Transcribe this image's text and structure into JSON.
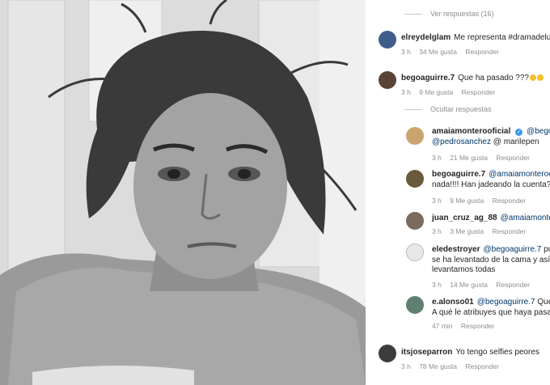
{
  "photo": {
    "alt": ""
  },
  "comments": {
    "view_replies": "Ver respuestas (16)",
    "hide_replies": "Ocultar respuestas",
    "items": [
      {
        "user": "elreydelglam",
        "text": "Me representa #dramadelun",
        "time": "3 h",
        "likes": "34 Me gusta",
        "reply": "Responder"
      },
      {
        "user": "begoaguirre.7",
        "text": "Que ha pasado ???",
        "time": "3 h",
        "likes": "9 Me gusta",
        "reply": "Responder"
      }
    ],
    "replies": [
      {
        "user": "amaiamonterooficial",
        "mention1": "@begoa",
        "mention2": "@pedrosanchez",
        "text2": "@ marilepen",
        "time": "3 h",
        "likes": "21 Me gusta",
        "reply": "Responder"
      },
      {
        "user": "begoaguirre.7",
        "mention1": "@amaiamonteroo",
        "line2": "nada!!!! Han jadeando la cuenta?",
        "time": "3 h",
        "likes": "9 Me gusta",
        "reply": "Responder"
      },
      {
        "user": "juan_cruz_ag_88",
        "mention1": "@amaiamonte",
        "time": "3 h",
        "likes": "3 Me gusta",
        "reply": "Responder"
      },
      {
        "user": "eledestroyer",
        "mention1": "@begoaguirre.7",
        "text1": "pu",
        "line2": "se ha levantado de la cama y así",
        "line3": "levantamos todas",
        "time": "3 h",
        "likes": "14 Me gusta",
        "reply": "Responder"
      },
      {
        "user": "e.alonso01",
        "mention1": "@begoaguirre.7",
        "text1": "Qué",
        "line2": "A qué le atribuyes que haya pasa",
        "time": "47 min",
        "reply": "Responder"
      }
    ],
    "last": {
      "user": "itsjoseparron",
      "text": "Yo tengo selfies peores",
      "time": "3 h",
      "likes": "78 Me gusta",
      "reply": "Responder"
    }
  }
}
